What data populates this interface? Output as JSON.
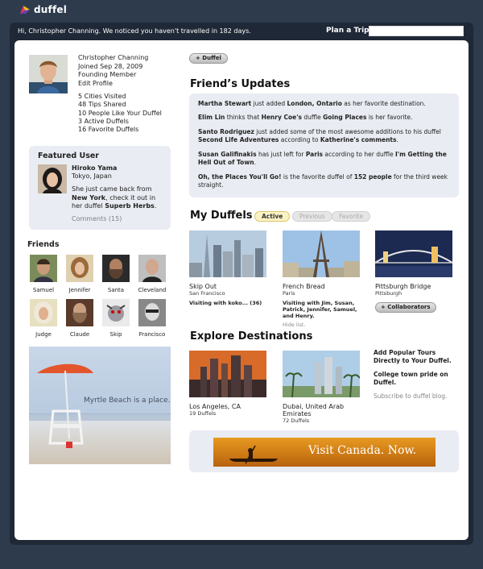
{
  "app": {
    "name": "duffel"
  },
  "header": {
    "greeting": "Hi, Christopher Channing. We noticed you haven't travelled in 182 days.",
    "plan_label": "Plan a Trip",
    "plan_value": ""
  },
  "profile": {
    "name": "Christopher Channing",
    "joined": "Joined Sep 28, 2009",
    "membership": "Founding Member",
    "edit_label": "Edit Profile",
    "stats": [
      "5 Cities Visited",
      "48 Tips Shared",
      "10 People Like Your Duffel",
      "3 Active Duffels",
      "16 Favorite Duffels"
    ]
  },
  "featured": {
    "title": "Featured User",
    "name": "Hiroko Yama",
    "location": "Tokyo, Japan",
    "text_1": "She just came back from",
    "city": "New York",
    "text_2": ", check it out in her duffel",
    "duffel": "Superb Herbs",
    "text_3": ".",
    "comments": "Comments (15)"
  },
  "friends": {
    "title": "Friends",
    "items": [
      {
        "name": "Samuel"
      },
      {
        "name": "Jennifer"
      },
      {
        "name": "Santa"
      },
      {
        "name": "Cleveland"
      },
      {
        "name": "Judge"
      },
      {
        "name": "Claude"
      },
      {
        "name": "Skip"
      },
      {
        "name": "Francisco"
      }
    ]
  },
  "beach_ad": {
    "text": "Myrtle Beach is a place."
  },
  "main": {
    "duffel_button": "+ Duffel",
    "updates_title": "Friend’s Updates",
    "updates": [
      {
        "p1": "Martha Stewart",
        "p2": " just added ",
        "p3": "London, Ontario",
        "p4": " as her favorite destination."
      },
      {
        "p1": "Elim Lin",
        "p2": " thinks that ",
        "p3": "Henry Coe's",
        "p4": " duffle ",
        "p5": "Going Places",
        "p6": " is her favorite."
      },
      {
        "p1": "Santo Rodriguez",
        "p2": " just added some of the most awesome additions to his duffel ",
        "p3": "Second Life Adventures",
        "p4": " according to ",
        "p5": "Katherine's comments",
        "p6": "."
      },
      {
        "p1": "Susan Galifinakis",
        "p2": " has just left for ",
        "p3": "Paris",
        "p4": " according to her duffle ",
        "p5": "I'm Getting the Hell Out of Town",
        "p6": "."
      },
      {
        "p1": "Oh, the Places You'll Go!",
        "p2": " is the favorite duffel of ",
        "p3": "152 people",
        "p4": " for the third week straight."
      }
    ],
    "my_duffels_title": "My Duffels",
    "tabs": {
      "active": "Active",
      "previous": "Previous",
      "favorite": "Favorite"
    },
    "duffels": [
      {
        "title": "Skip Out",
        "city": "San Francisco",
        "visiting": "Visiting with koko... (36)"
      },
      {
        "title": "French Bread",
        "city": "Paris",
        "visiting": "Visiting with Jim, Susan, Patrick, Jennifer, Samuel, and Henry.",
        "hide": "Hide list."
      },
      {
        "title": "Pittsburgh Bridge",
        "city": "Pittsburgh",
        "button": "+ Collaborators"
      }
    ],
    "explore_title": "Explore Destinations",
    "destinations": [
      {
        "title": "Los Angeles, CA",
        "count": "19 Duffels"
      },
      {
        "title": "Dubai, United Arab Emirates",
        "count": "72 Duffels"
      }
    ],
    "promo_1": "Add Popular Tours Directly to Your Duffel.",
    "promo_2": "College town pride on Duffel.",
    "subscribe": "Subscribe to duffel blog.",
    "canada_ad": "Visit Canada. Now."
  }
}
